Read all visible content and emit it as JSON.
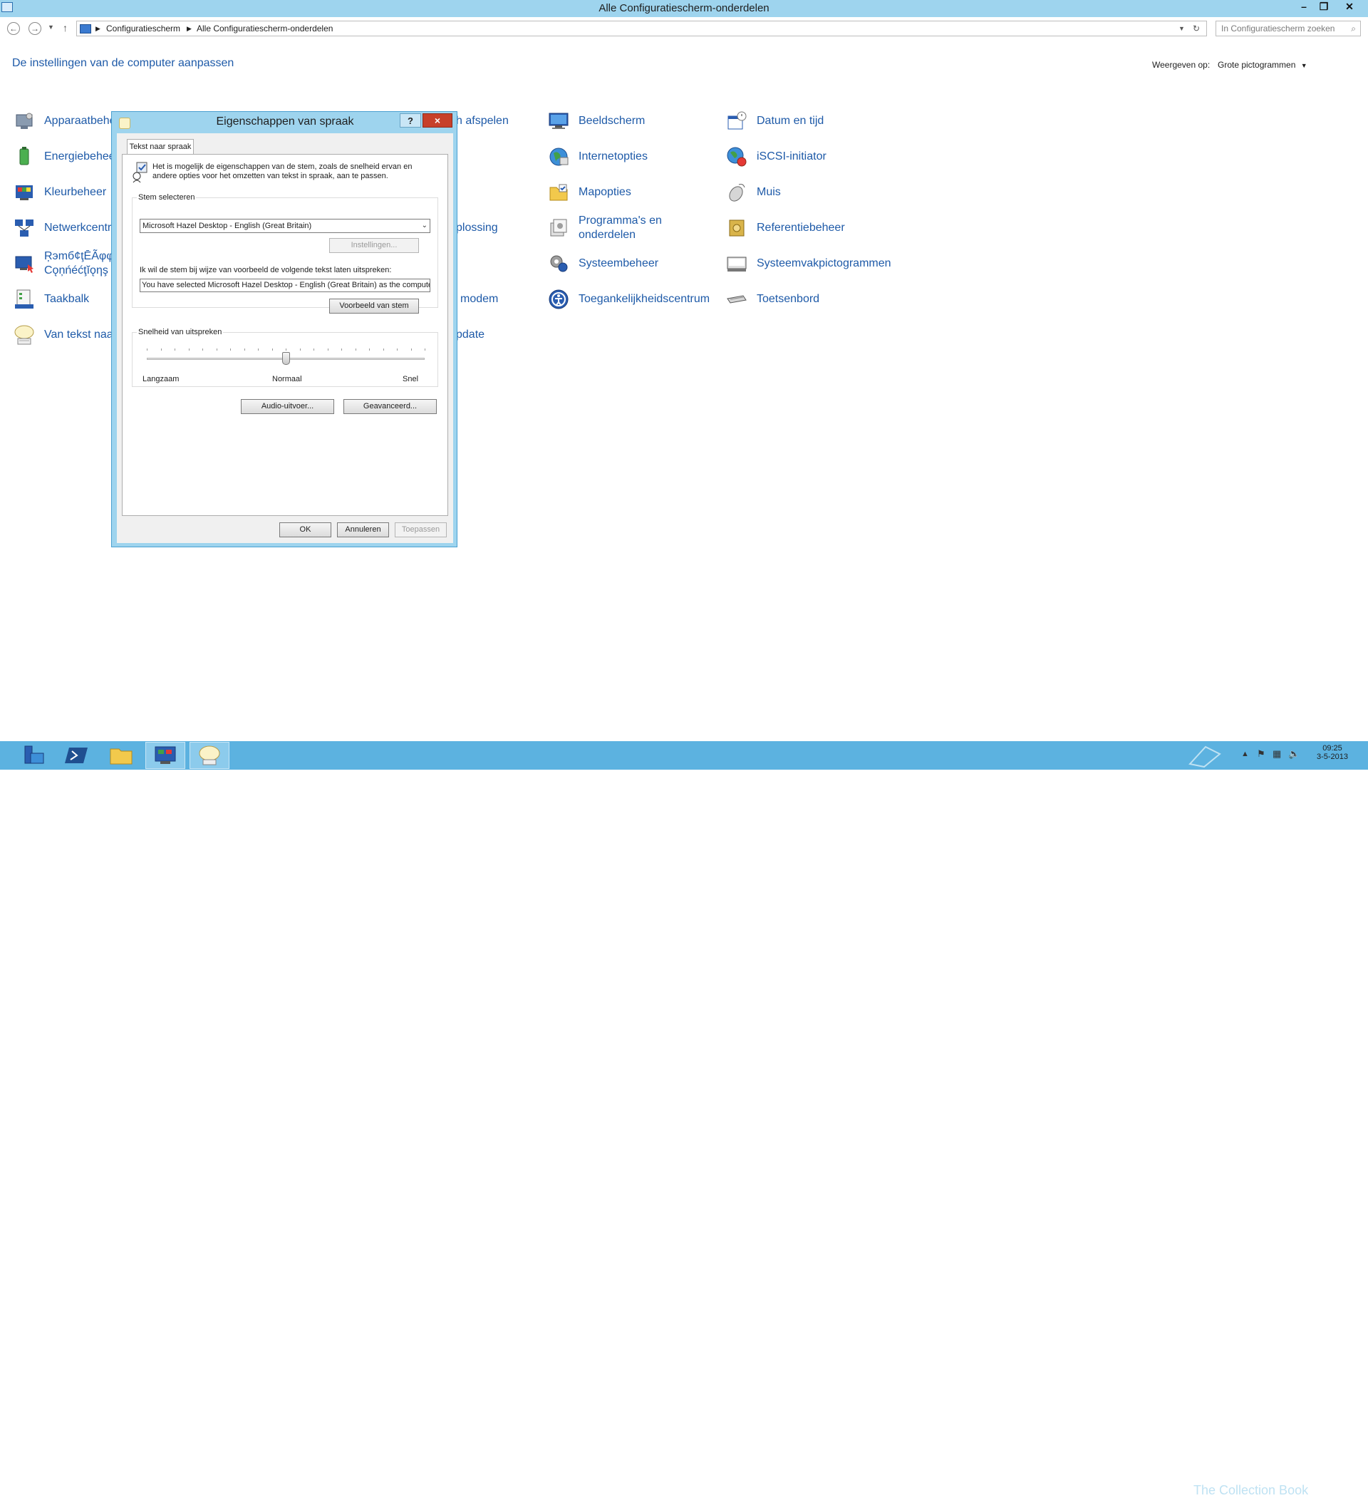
{
  "window": {
    "title": "Alle Configuratiescherm-onderdelen",
    "controls": [
      "minimize",
      "restore",
      "close"
    ]
  },
  "nav": {
    "back_icon": "back-arrow-icon",
    "forward_icon": "forward-arrow-icon",
    "recent_icon": "chevron-down-icon",
    "up_icon": "up-arrow-icon",
    "breadcrumb": [
      "Configuratiescherm",
      "Alle Configuratiescherm-onderdelen"
    ],
    "search_placeholder": "In Configuratiescherm zoeken"
  },
  "page": {
    "heading": "De instellingen van de computer aanpassen",
    "view_label": "Weergeven op:",
    "view_value": "Grote pictogrammen"
  },
  "items": {
    "apparaatbeheer": "Apparaatbehe",
    "energiebeheer": "Energiebehee",
    "kleurbeheer": "Kleurbeheer",
    "netwerkcentrum": "Netwerkcentr",
    "remoteapp_line1": "Ŗэmб¢ţĒÃφφ ó",
    "remoteapp_line2": "Cǫņńéćţĭǫηş",
    "taakbalk": "Taakbalk",
    "van_tekst_naar_spraak": "Van tekst naa",
    "automatisch_afspelen": "h afspelen",
    "probleemoplossing": "plossing",
    "telefoon_modem": "modem",
    "windows_update": "pdate",
    "beeldscherm": "Beeldscherm",
    "internetopties": "Internetopties",
    "mapopties": "Mapopties",
    "programmas_line1": "Programma's en",
    "programmas_line2": "onderdelen",
    "systeembeheer": "Systeembeheer",
    "toegankelijkheidscentrum": "Toegankelijkheidscentrum",
    "datum_en_tijd": "Datum en tijd",
    "iscsi": "iSCSI-initiator",
    "muis": "Muis",
    "referentiebeheer": "Referentiebeheer",
    "systeemvak": "Systeemvakpictogrammen",
    "toetsenbord": "Toetsenbord"
  },
  "dialog": {
    "title": "Eigenschappen van spraak",
    "help": "?",
    "close": "×",
    "tab": "Tekst naar spraak",
    "intro": "Het is mogelijk de eigenschappen van de stem, zoals de snelheid ervan en andere opties voor het omzetten van tekst in spraak, aan te passen.",
    "voice_group": "Stem selecteren",
    "voice_selected": "Microsoft Hazel Desktop - English (Great Britain)",
    "settings_button": "Instellingen...",
    "preview_label": "Ik wil de stem bij wijze van voorbeeld de volgende tekst laten uitspreken:",
    "preview_text": "You have selected Microsoft Hazel Desktop - English (Great Britain) as the computer's default voice.",
    "preview_button": "Voorbeeld van stem",
    "speed_group": "Snelheid van uitspreken",
    "speed_value": 0.5,
    "speed_slow": "Langzaam",
    "speed_normal": "Normaal",
    "speed_fast": "Snel",
    "audio_button": "Audio-uitvoer...",
    "advanced_button": "Geavanceerd...",
    "ok": "OK",
    "cancel": "Annuleren",
    "apply": "Toepassen"
  },
  "taskbar": {
    "apps": [
      "server-manager-icon",
      "powershell-icon",
      "file-explorer-icon",
      "control-panel-icon",
      "speech-icon"
    ],
    "time": "09:25",
    "date": "3-5-2013",
    "watermark": "The Collection Book"
  }
}
